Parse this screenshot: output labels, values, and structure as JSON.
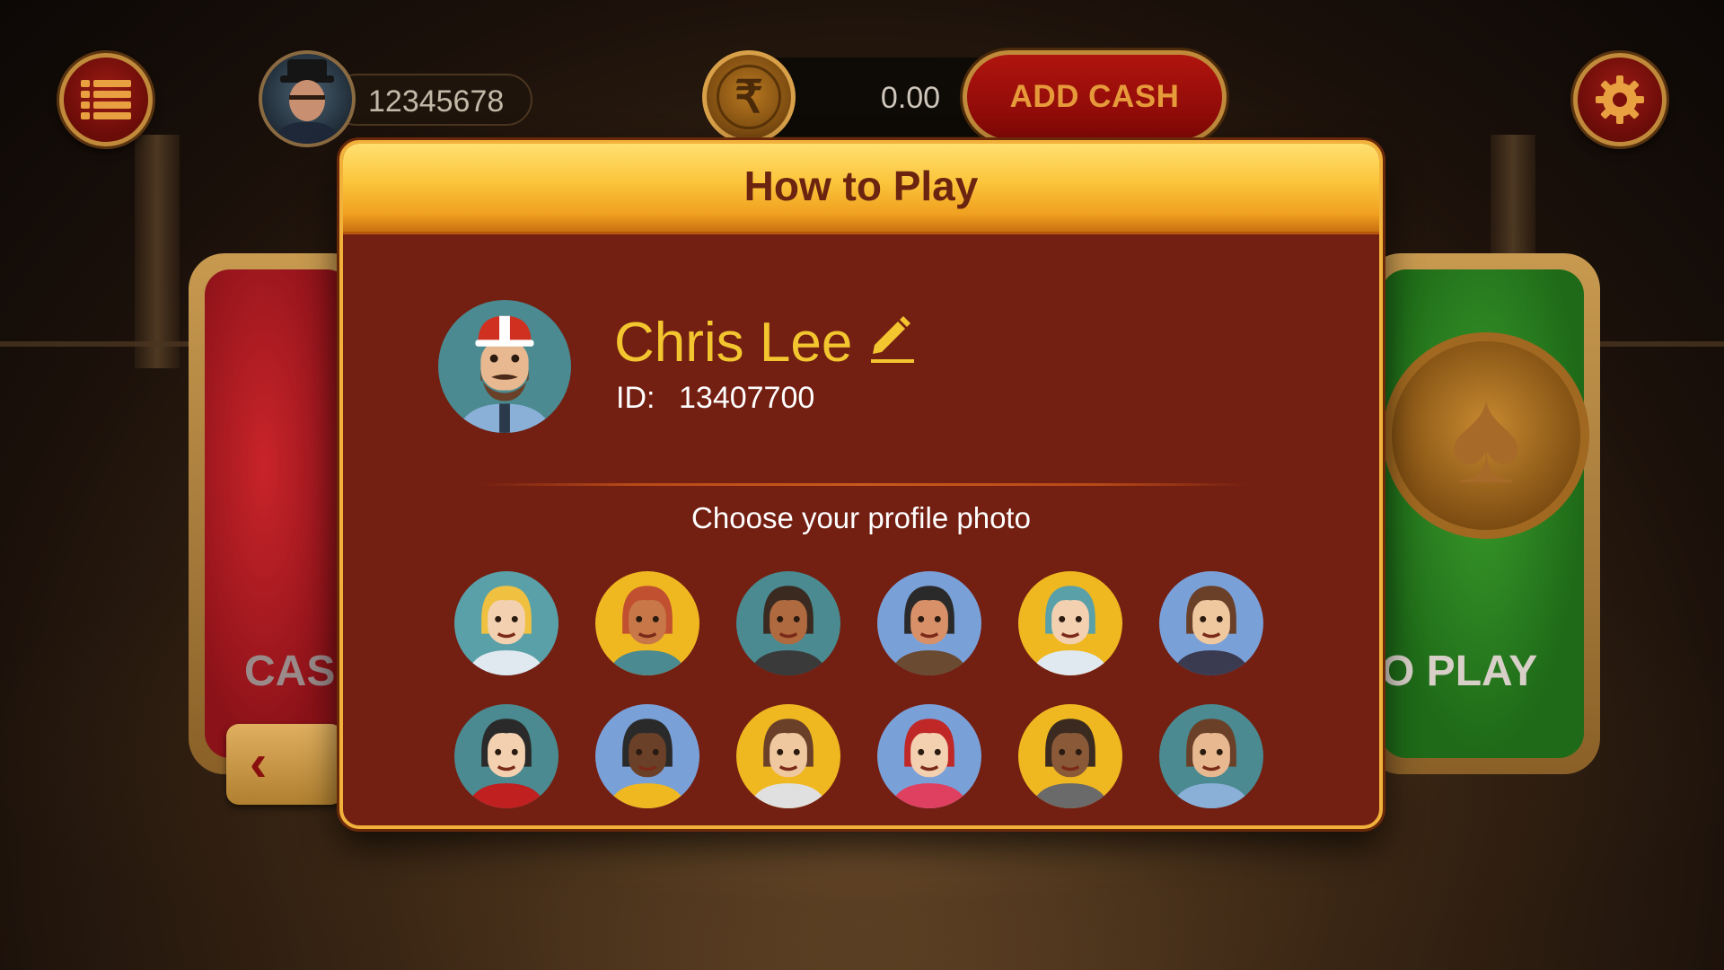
{
  "header": {
    "player_id": "12345678",
    "balance": "0.00",
    "currency_symbol": "₹",
    "add_cash_label": "ADD CASH",
    "menu_icon": "list-icon",
    "settings_icon": "gear-icon"
  },
  "side_cards": {
    "left_label": "CAS",
    "right_label": "O PLAY"
  },
  "dialog": {
    "title": "How to Play",
    "profile": {
      "name": "Chris Lee",
      "id_label": "ID:",
      "id_value": "13407700"
    },
    "choose_label": "Choose your profile photo",
    "avatars": [
      {
        "icon": "avatar-blonde-woman-glasses",
        "bg": "#5aa0a8",
        "skin": "#f3d0b0",
        "hair": "#f0c040",
        "shirt": "#e0e8f0"
      },
      {
        "icon": "avatar-man-teal-hat",
        "bg": "#f0b820",
        "skin": "#c87848",
        "hair": "#c05030",
        "shirt": "#4a8a90"
      },
      {
        "icon": "avatar-woman-white-hat",
        "bg": "#4a8a90",
        "skin": "#b06a40",
        "hair": "#3a2a20",
        "shirt": "#3a3a3a"
      },
      {
        "icon": "avatar-bearded-man",
        "bg": "#7aa0d8",
        "skin": "#d89068",
        "hair": "#2a2a2a",
        "shirt": "#6a4a30"
      },
      {
        "icon": "avatar-teal-hair-woman",
        "bg": "#f0b820",
        "skin": "#f3d0b0",
        "hair": "#5aa0a8",
        "shirt": "#e0e8f0"
      },
      {
        "icon": "avatar-hipster-glasses",
        "bg": "#7aa0d8",
        "skin": "#f0c8a0",
        "hair": "#6a4028",
        "shirt": "#3a3a50"
      },
      {
        "icon": "avatar-woman-bangs",
        "bg": "#4a8a90",
        "skin": "#f3d0b0",
        "hair": "#2a2a2a",
        "shirt": "#c02020"
      },
      {
        "icon": "avatar-man-yellow-glasses",
        "bg": "#7aa0d8",
        "skin": "#6a4028",
        "hair": "#2a2a2a",
        "shirt": "#f0b820"
      },
      {
        "icon": "avatar-mustache-bowtie",
        "bg": "#f0b820",
        "skin": "#f0c8a0",
        "hair": "#6a4028",
        "shirt": "#e0e0e0"
      },
      {
        "icon": "avatar-redhead-woman",
        "bg": "#7aa0d8",
        "skin": "#f3d0b0",
        "hair": "#c02828",
        "shirt": "#e04060"
      },
      {
        "icon": "avatar-man-braids",
        "bg": "#f0b820",
        "skin": "#8a5a38",
        "hair": "#3a2a20",
        "shirt": "#6a6a6a"
      },
      {
        "icon": "avatar-cap-mustache",
        "bg": "#4a8a90",
        "skin": "#e8b890",
        "hair": "#6a4028",
        "shirt": "#8ab0d8"
      }
    ]
  }
}
